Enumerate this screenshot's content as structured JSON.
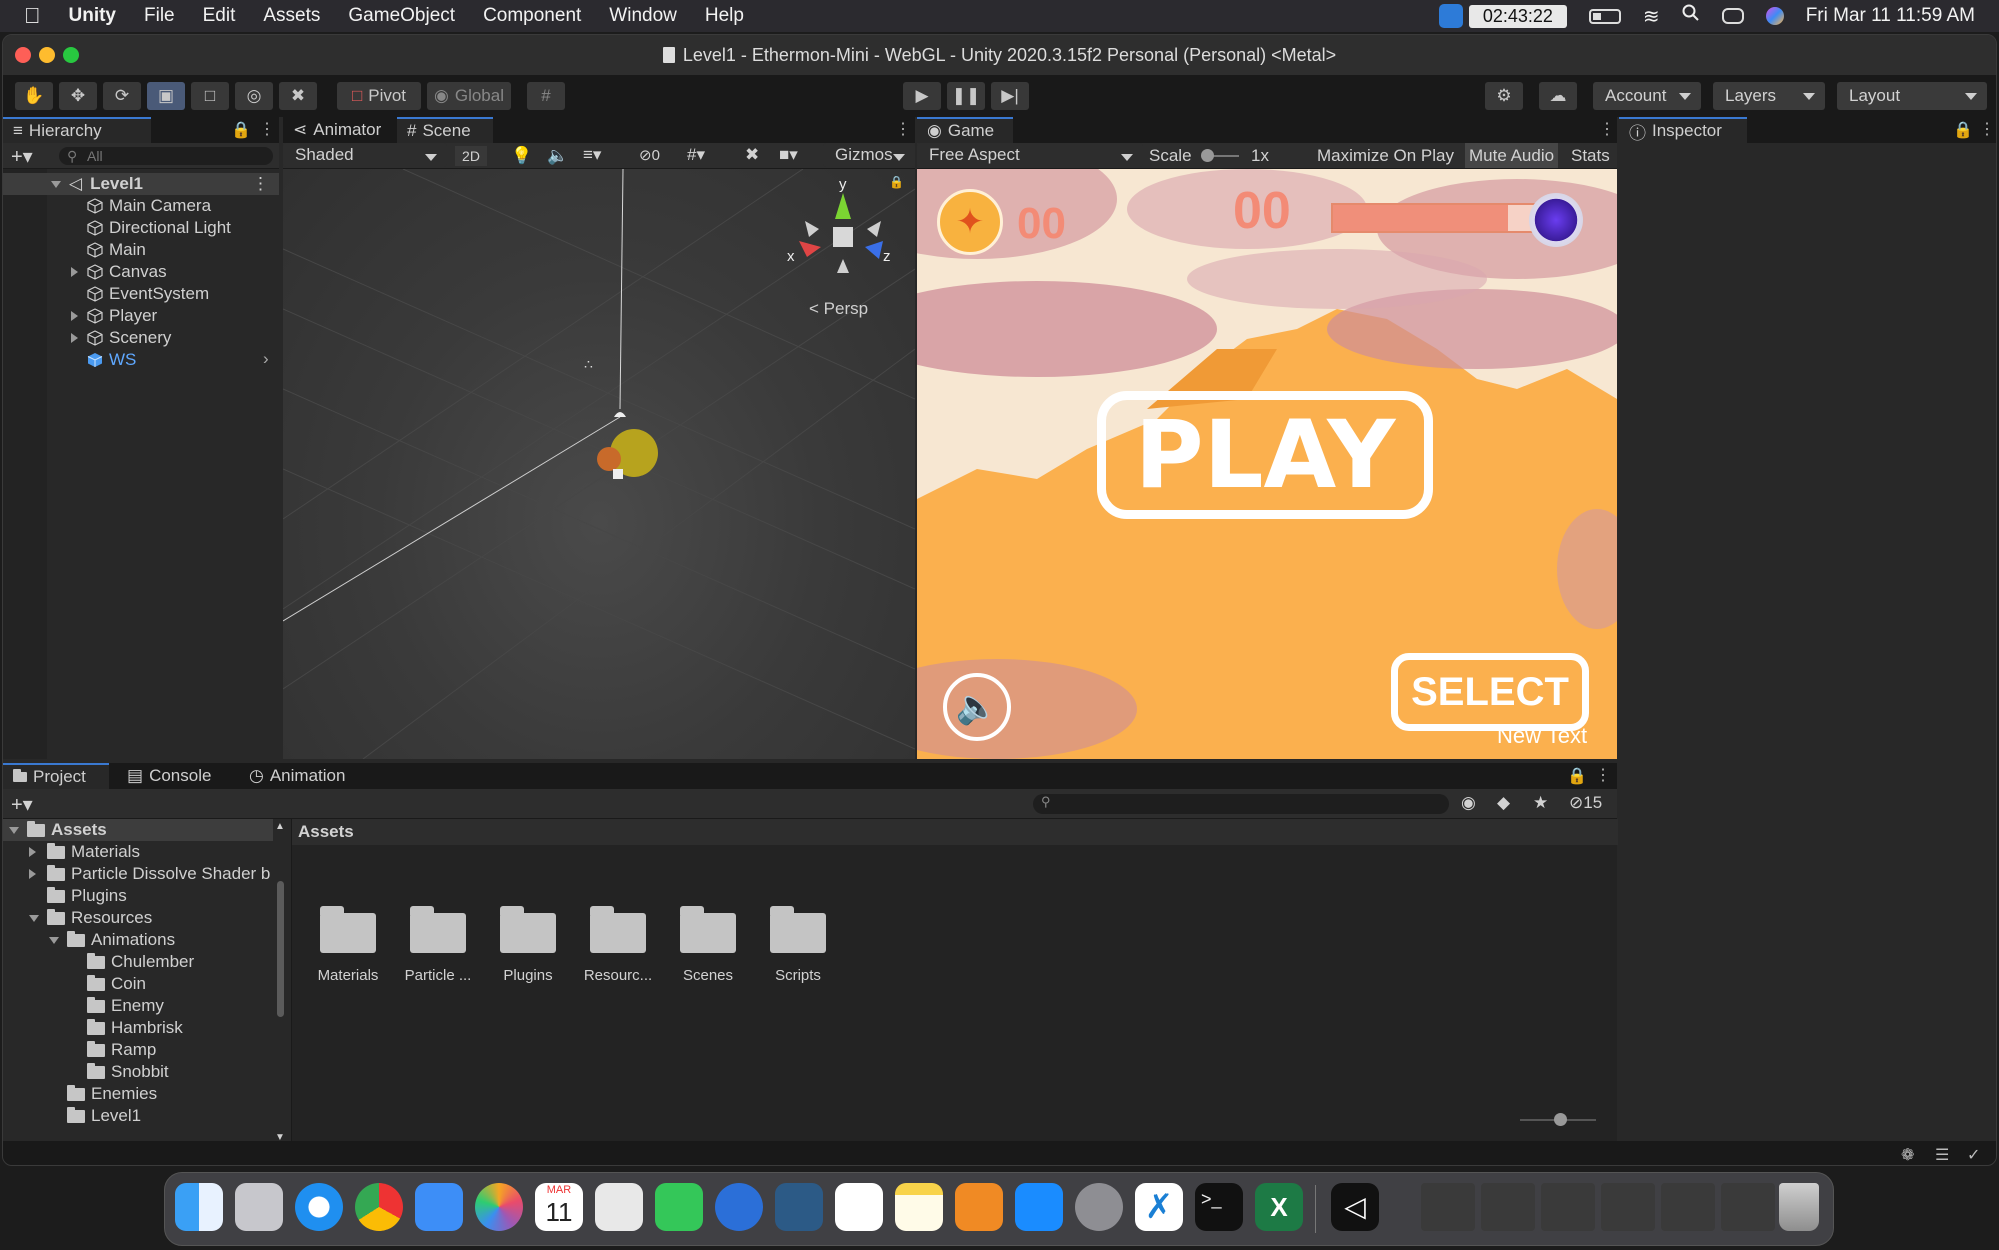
{
  "menubar": {
    "app_name": "Unity",
    "items": [
      "File",
      "Edit",
      "Assets",
      "GameObject",
      "Component",
      "Window",
      "Help"
    ],
    "timer": "02:43:22",
    "datetime": "Fri Mar 11  11:59 AM"
  },
  "window": {
    "title": "Level1 - Ethermon-Mini - WebGL - Unity 2020.3.15f2 Personal (Personal) <Metal>"
  },
  "toolbar": {
    "pivot_label": "Pivot",
    "global_label": "Global",
    "account_label": "Account",
    "layers_label": "Layers",
    "layout_label": "Layout"
  },
  "hierarchy": {
    "tab_label": "Hierarchy",
    "search_placeholder": "All",
    "root": "Level1",
    "items": [
      {
        "label": "Main Camera"
      },
      {
        "label": "Directional Light"
      },
      {
        "label": "Main"
      },
      {
        "label": "Canvas"
      },
      {
        "label": "EventSystem"
      },
      {
        "label": "Player"
      },
      {
        "label": "Scenery"
      },
      {
        "label": "WS"
      }
    ]
  },
  "scene": {
    "tabs": [
      "Animator",
      "Scene"
    ],
    "shading": "Shaded",
    "mode_2d": "2D",
    "hidden_count": "0",
    "gizmos_label": "Gizmos",
    "persp_label": "Persp",
    "axis_x": "x",
    "axis_y": "y",
    "axis_z": "z"
  },
  "game": {
    "tab_label": "Game",
    "aspect": "Free Aspect",
    "scale_label": "Scale",
    "scale_value": "1x",
    "maximize_label": "Maximize On Play",
    "mute_label": "Mute Audio",
    "stats_label": "Stats",
    "score_left": "00",
    "score_center": "00",
    "play_label": "PLAY",
    "select_label": "SELECT",
    "new_text": "New Text",
    "health_fraction": 0.85
  },
  "inspector": {
    "tab_label": "Inspector"
  },
  "bottom": {
    "tabs": [
      "Project",
      "Console",
      "Animation"
    ],
    "hidden_count": "15",
    "breadcrumb": "Assets",
    "tree": [
      {
        "label": "Assets"
      },
      {
        "label": "Materials"
      },
      {
        "label": "Particle Dissolve Shader b"
      },
      {
        "label": "Plugins"
      },
      {
        "label": "Resources"
      },
      {
        "label": "Animations"
      },
      {
        "label": "Chulember"
      },
      {
        "label": "Coin"
      },
      {
        "label": "Enemy"
      },
      {
        "label": "Hambrisk"
      },
      {
        "label": "Ramp"
      },
      {
        "label": "Snobbit"
      },
      {
        "label": "Enemies"
      },
      {
        "label": "Level1"
      }
    ],
    "assets": [
      {
        "label": "Materials"
      },
      {
        "label": "Particle ..."
      },
      {
        "label": "Plugins"
      },
      {
        "label": "Resourc..."
      },
      {
        "label": "Scenes"
      },
      {
        "label": "Scripts"
      }
    ]
  },
  "dock": {
    "calendar_month": "MAR",
    "calendar_day": "11"
  },
  "colors": {
    "accent": "#3a79d1",
    "game_orange": "#fbb04e",
    "score_coral": "#f38b76"
  }
}
